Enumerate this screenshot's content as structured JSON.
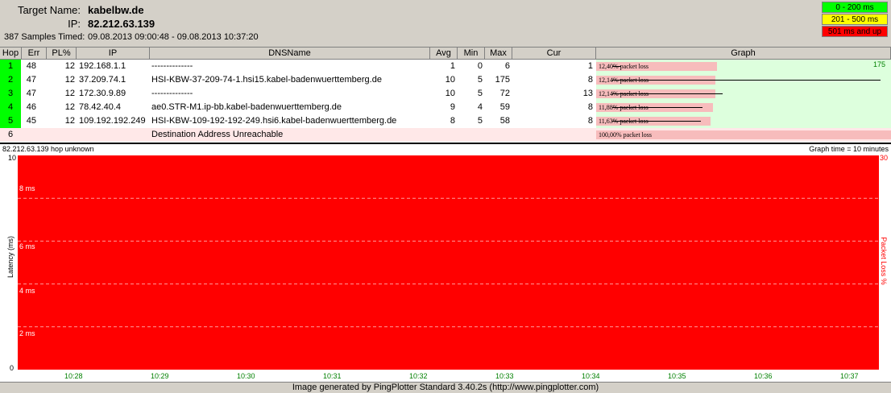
{
  "header": {
    "target_label": "Target Name:",
    "target_value": "kabelbw.de",
    "ip_label": "IP:",
    "ip_value": "82.212.63.139",
    "samples_label": "387 Samples Timed:",
    "samples_value": "09.08.2013 09:00:48 - 09.08.2013 10:37:20"
  },
  "legend": [
    {
      "label": "0 - 200 ms",
      "color": "#00ff00"
    },
    {
      "label": "201 - 500 ms",
      "color": "#ffff00"
    },
    {
      "label": "501 ms and up",
      "color": "#ff0000"
    }
  ],
  "columns": [
    "Hop",
    "Err",
    "PL%",
    "IP",
    "DNSName",
    "Avg",
    "Min",
    "Max",
    "Cur",
    "Graph"
  ],
  "graph_max_label": "175",
  "hops": [
    {
      "hop": "1",
      "err": "48",
      "pl": "12",
      "ip": "192.168.1.1",
      "dns": "--------------",
      "avg": "1",
      "min": "0",
      "max": "6",
      "cur": "1",
      "loss_text": "12,40% packet loss"
    },
    {
      "hop": "2",
      "err": "47",
      "pl": "12",
      "ip": "37.209.74.1",
      "dns": "HSI-KBW-37-209-74-1.hsi15.kabel-badenwuerttemberg.de",
      "avg": "10",
      "min": "5",
      "max": "175",
      "cur": "8",
      "loss_text": "12,14% packet loss"
    },
    {
      "hop": "3",
      "err": "47",
      "pl": "12",
      "ip": "172.30.9.89",
      "dns": "--------------",
      "avg": "10",
      "min": "5",
      "max": "72",
      "cur": "13",
      "loss_text": "12,14% packet loss"
    },
    {
      "hop": "4",
      "err": "46",
      "pl": "12",
      "ip": "78.42.40.4",
      "dns": "ae0.STR-M1.ip-bb.kabel-badenwuerttemberg.de",
      "avg": "9",
      "min": "4",
      "max": "59",
      "cur": "8",
      "loss_text": "11,88% packet loss"
    },
    {
      "hop": "5",
      "err": "45",
      "pl": "12",
      "ip": "109.192.192.249",
      "dns": "HSI-KBW-109-192-192-249.hsi6.kabel-badenwuerttemberg.de",
      "avg": "8",
      "min": "5",
      "max": "58",
      "cur": "8",
      "loss_text": "11,63% packet loss"
    }
  ],
  "last_row": {
    "hop": "6",
    "dns": "Destination Address Unreachable",
    "loss_text": "100,00% packet loss"
  },
  "chart": {
    "left_title": "82.212.63.139 hop unknown",
    "right_title": "Graph time = 10 minutes",
    "y_axis_label": "Latency (ms)",
    "y2_axis_label": "Packet Loss %",
    "y_top": "10",
    "y_bottom": "0",
    "y2_top": "30",
    "ms_labels": [
      "8 ms",
      "6 ms",
      "4 ms",
      "2 ms"
    ],
    "x_ticks": [
      "10:28",
      "10:29",
      "10:30",
      "10:31",
      "10:32",
      "10:33",
      "10:34",
      "10:35",
      "10:36",
      "10:37"
    ],
    "fill_color": "#ff0000"
  },
  "footer": "Image generated by PingPlotter Standard 3.40.2s (http://www.pingplotter.com)"
}
